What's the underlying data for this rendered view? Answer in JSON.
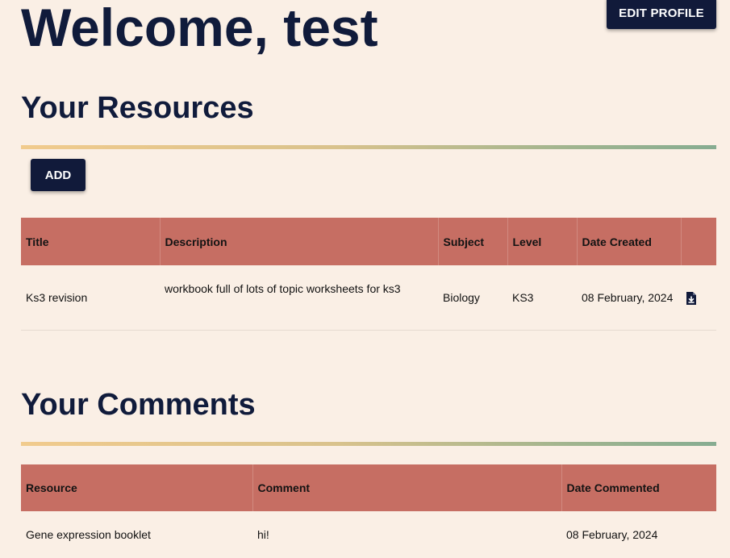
{
  "header": {
    "welcome": "Welcome, test",
    "edit_profile_label": "EDIT PROFILE"
  },
  "resources": {
    "title": "Your Resources",
    "add_label": "ADD",
    "columns": [
      "Title",
      "Description",
      "Subject",
      "Level",
      "Date Created",
      ""
    ],
    "rows": [
      {
        "title": "Ks3 revision",
        "description": "workbook full of lots of topic worksheets for ks3",
        "subject": "Biology",
        "level": "KS3",
        "date_created": "08 February, 2024",
        "action_icon": "download-file-icon"
      }
    ]
  },
  "comments": {
    "title": "Your Comments",
    "columns": [
      "Resource",
      "Comment",
      "Date Commented"
    ],
    "rows": [
      {
        "resource": "Gene expression booklet",
        "comment": "hi!",
        "date_commented": "08 February, 2024"
      }
    ]
  },
  "colors": {
    "background": "#faefe5",
    "primary_navy": "#111a3a",
    "table_header": "#c66e63",
    "gradient_start": "#f1cb8d",
    "gradient_end": "#86ac91"
  }
}
